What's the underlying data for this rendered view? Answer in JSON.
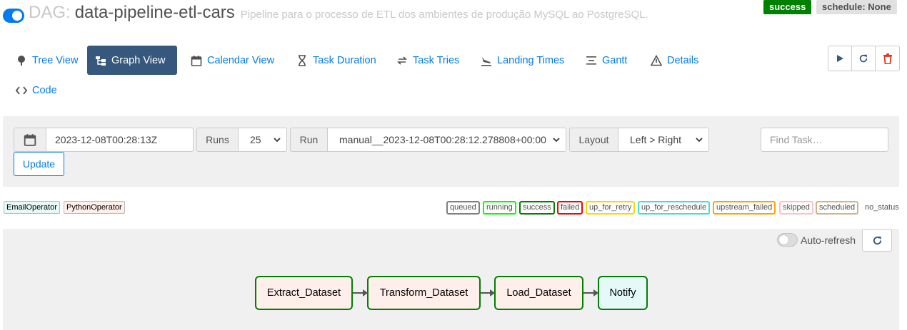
{
  "header": {
    "dag_prefix": "DAG:",
    "dag_id": "data-pipeline-etl-cars",
    "description": "Pipeline para o processo de ETL dos ambientes de produção MySQL ao PostgreSQL.",
    "status_badge": "success",
    "schedule_badge": "schedule: None",
    "paused_toggle": "on"
  },
  "nav": {
    "tabs": [
      {
        "label": "Tree View",
        "icon": "tree-icon"
      },
      {
        "label": "Graph View",
        "icon": "graph-icon",
        "active": true
      },
      {
        "label": "Calendar View",
        "icon": "calendar-icon"
      },
      {
        "label": "Task Duration",
        "icon": "hourglass-icon"
      },
      {
        "label": "Task Tries",
        "icon": "retry-arrows-icon"
      },
      {
        "label": "Landing Times",
        "icon": "plane-landing-icon"
      },
      {
        "label": "Gantt",
        "icon": "gantt-icon"
      },
      {
        "label": "Details",
        "icon": "warning-triangle-icon"
      }
    ],
    "code": {
      "label": "Code",
      "icon": "code-icon"
    },
    "actions": [
      "play-icon",
      "refresh-icon",
      "trash-icon"
    ]
  },
  "filters": {
    "base_date": "2023-12-08T00:28:13Z",
    "runs_label": "Runs",
    "runs_value": "25",
    "run_label": "Run",
    "run_value": "manual__2023-12-08T00:28:12.278808+00:00",
    "layout_label": "Layout",
    "layout_value": "Left > Right",
    "find_placeholder": "Find Task…",
    "update_label": "Update"
  },
  "operators": [
    {
      "label": "EmailOperator",
      "color": "#e6f9f9"
    },
    {
      "label": "PythonOperator",
      "color": "#ffefeb"
    }
  ],
  "states": [
    {
      "label": "queued",
      "color": "#808080"
    },
    {
      "label": "running",
      "color": "#00ff00"
    },
    {
      "label": "success",
      "color": "#008000"
    },
    {
      "label": "failed",
      "color": "#ff0000"
    },
    {
      "label": "up_for_retry",
      "color": "#ffd700"
    },
    {
      "label": "up_for_reschedule",
      "color": "#40e0d0"
    },
    {
      "label": "upstream_failed",
      "color": "#ffa500"
    },
    {
      "label": "skipped",
      "color": "#ffc0cb"
    },
    {
      "label": "scheduled",
      "color": "#d2b48c"
    },
    {
      "label": "no_status",
      "color": ""
    }
  ],
  "graph": {
    "autorefresh_label": "Auto-refresh",
    "tasks": [
      {
        "label": "Extract_Dataset",
        "operator": "PythonOperator",
        "state": "success"
      },
      {
        "label": "Transform_Dataset",
        "operator": "PythonOperator",
        "state": "success"
      },
      {
        "label": "Load_Dataset",
        "operator": "PythonOperator",
        "state": "success"
      },
      {
        "label": "Notify",
        "operator": "EmailOperator",
        "state": "success"
      }
    ]
  },
  "colors": {
    "accent": "#017cee",
    "active_tab": "#36587d",
    "success": "#008000"
  }
}
